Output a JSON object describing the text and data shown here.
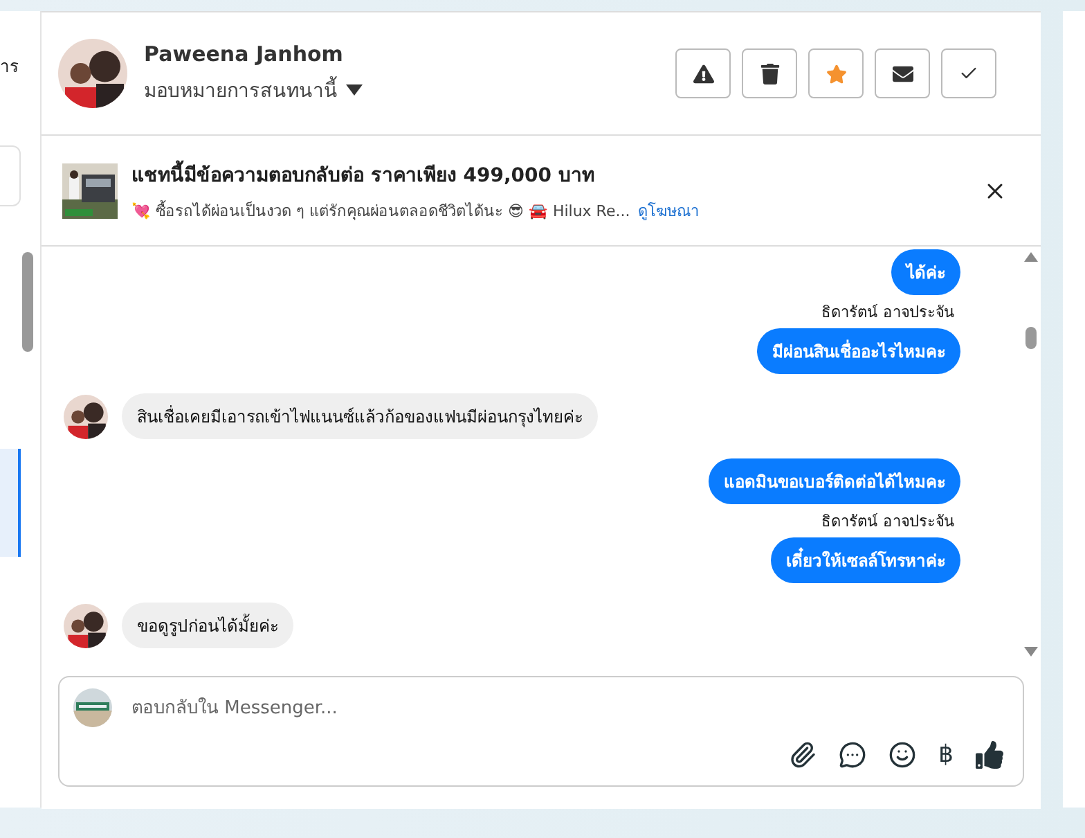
{
  "sidebar": {
    "fragment": "าร"
  },
  "header": {
    "name": "Paweena Janhom",
    "assign": "มอบหมายการสนทนานี้",
    "actions": [
      {
        "kind": "alert",
        "selected": false
      },
      {
        "kind": "trash",
        "selected": false
      },
      {
        "kind": "star",
        "selected": true
      },
      {
        "kind": "mail",
        "selected": false
      },
      {
        "kind": "check",
        "selected": false
      }
    ]
  },
  "ad": {
    "title": "แชทนี้มีข้อความตอบกลับต่อ ราคาเพียง 499,000 บาท",
    "subtitle": "💘 ซื้อรถได้ผ่อนเป็นงวด ๆ แต่รักคุณผ่อนตลอดชีวิตได้นะ 😎 🚘 Hilux Re...",
    "link": "ดูโฆษณา"
  },
  "messages": [
    {
      "kind": "outgoing",
      "text": "ได้ค่ะ"
    },
    {
      "kind": "sender",
      "text": "ธิดารัตน์ อาจประจัน"
    },
    {
      "kind": "outgoing",
      "text": "มีผ่อนสินเชื่ออะไรไหมคะ"
    },
    {
      "kind": "incoming",
      "text": "สินเชื่อเคยมีเอารถเข้าไฟแนนซ์แล้วก้อของแฟนมีผ่อนกรุงไทยค่ะ"
    },
    {
      "kind": "outgoing",
      "text": "แอดมินขอเบอร์ติดต่อได้ไหมคะ"
    },
    {
      "kind": "sender",
      "text": "ธิดารัตน์ อาจประจัน"
    },
    {
      "kind": "outgoing",
      "text": "เดี๋ยวให้เซลล์โทรหาค่ะ"
    },
    {
      "kind": "incoming",
      "text": "ขอดูรูปก่อนได้มั้ยค่ะ"
    }
  ],
  "composer": {
    "placeholder": "ตอบกลับใน Messenger...",
    "tools": [
      {
        "kind": "attach"
      },
      {
        "kind": "chat"
      },
      {
        "kind": "emoji"
      },
      {
        "kind": "baht",
        "label": "฿"
      },
      {
        "kind": "like"
      }
    ]
  }
}
